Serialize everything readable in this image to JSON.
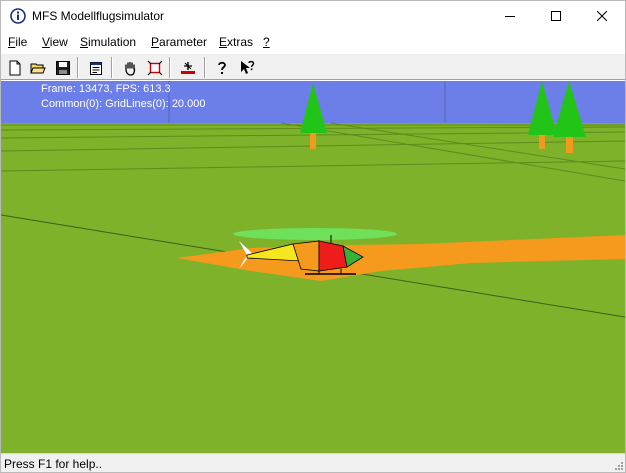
{
  "window": {
    "title": "MFS Modellflugsimulator"
  },
  "menu": {
    "items": [
      {
        "accel": "F",
        "rest": "ile"
      },
      {
        "accel": "V",
        "rest": "iew"
      },
      {
        "accel": "S",
        "rest": "imulation"
      },
      {
        "accel": "P",
        "rest": "arameter"
      },
      {
        "accel": "E",
        "rest": "xtras"
      },
      {
        "accel": "?",
        "rest": ""
      }
    ]
  },
  "toolbar": {
    "buttons": [
      "new-file-icon",
      "open-folder-icon",
      "save-disk-icon",
      "properties-icon",
      "hand-pan-icon",
      "zoom-fit-icon",
      "runway-icon",
      "help-icon",
      "context-help-icon"
    ]
  },
  "viewport": {
    "hud_line_1": "Frame: 13473, FPS: 613.3",
    "hud_line_2": "Common(0): GridLines(0): 20.000",
    "colors": {
      "sky": "#6c7ee8",
      "ground": "#7eb22a",
      "tree": "#22c418",
      "trunk": "#f09a1e",
      "shadow": "#f59a1c",
      "rotor": "#6fe05a",
      "cabin": "#ef1c1c"
    }
  },
  "status": {
    "text": "Press F1 for help.."
  }
}
